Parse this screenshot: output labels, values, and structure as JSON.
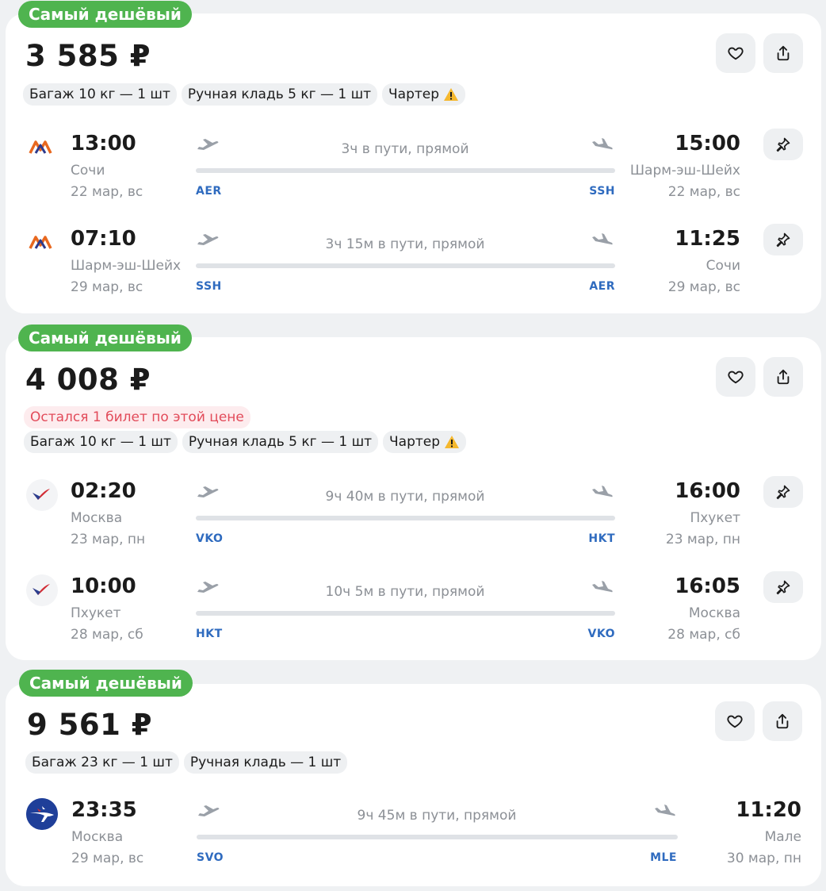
{
  "offers": [
    {
      "badge": "Самый дешёвый",
      "price": "3 585 ₽",
      "notice": "",
      "tags": [
        "Багаж 10 кг — 1 шт",
        "Ручная кладь 5 кг — 1 шт",
        "Чартер"
      ],
      "charter_warning_icon": "warning-icon",
      "airline_logo": "red-wings-logo",
      "segments": [
        {
          "dep_time": "13:00",
          "dep_city": "Сочи",
          "dep_date": "22 мар, вс",
          "dep_code": "AER",
          "duration": "3ч в пути, прямой",
          "arr_time": "15:00",
          "arr_city": "Шарм-эш-Шейх",
          "arr_date": "22 мар, вс",
          "arr_code": "SSH"
        },
        {
          "dep_time": "07:10",
          "dep_city": "Шарм-эш-Шейх",
          "dep_date": "29 мар, вс",
          "dep_code": "SSH",
          "duration": "3ч 15м в пути, прямой",
          "arr_time": "11:25",
          "arr_city": "Сочи",
          "arr_date": "29 мар, вс",
          "arr_code": "AER"
        }
      ]
    },
    {
      "badge": "Самый дешёвый",
      "price": "4 008 ₽",
      "notice": "Остался 1 билет по этой цене",
      "tags": [
        "Багаж 10 кг — 1 шт",
        "Ручная кладь 5 кг — 1 шт",
        "Чартер"
      ],
      "charter_warning_icon": "warning-icon",
      "airline_logo": "azur-air-logo",
      "segments": [
        {
          "dep_time": "02:20",
          "dep_city": "Москва",
          "dep_date": "23 мар, пн",
          "dep_code": "VKO",
          "duration": "9ч 40м в пути, прямой",
          "arr_time": "16:00",
          "arr_city": "Пхукет",
          "arr_date": "23 мар, пн",
          "arr_code": "HKT"
        },
        {
          "dep_time": "10:00",
          "dep_city": "Пхукет",
          "dep_date": "28 мар, сб",
          "dep_code": "HKT",
          "duration": "10ч 5м в пути, прямой",
          "arr_time": "16:05",
          "arr_city": "Москва",
          "arr_date": "28 мар, сб",
          "arr_code": "VKO"
        }
      ]
    },
    {
      "badge": "Самый дешёвый",
      "price": "9 561 ₽",
      "notice": "",
      "tags": [
        "Багаж 23 кг — 1 шт",
        "Ручная кладь — 1 шт"
      ],
      "airline_logo": "aeroflot-logo",
      "segments": [
        {
          "dep_time": "23:35",
          "dep_city": "Москва",
          "dep_date": "29 мар, вс",
          "dep_code": "SVO",
          "duration": "9ч 45м в пути, прямой",
          "arr_time": "11:20",
          "arr_city": "Мале",
          "arr_date": "30 мар, пн",
          "arr_code": "MLE"
        }
      ]
    }
  ],
  "icons": {
    "favorite": "heart-icon",
    "share": "share-icon",
    "pin": "pin-icon",
    "departure": "plane-takeoff-icon",
    "arrival": "plane-landing-icon"
  },
  "colors": {
    "badge": "#4fb44f",
    "airport_code": "#2f6bbf",
    "notice_text": "#e24b5a",
    "notice_bg": "#fdecee",
    "background": "#eff1f3"
  }
}
